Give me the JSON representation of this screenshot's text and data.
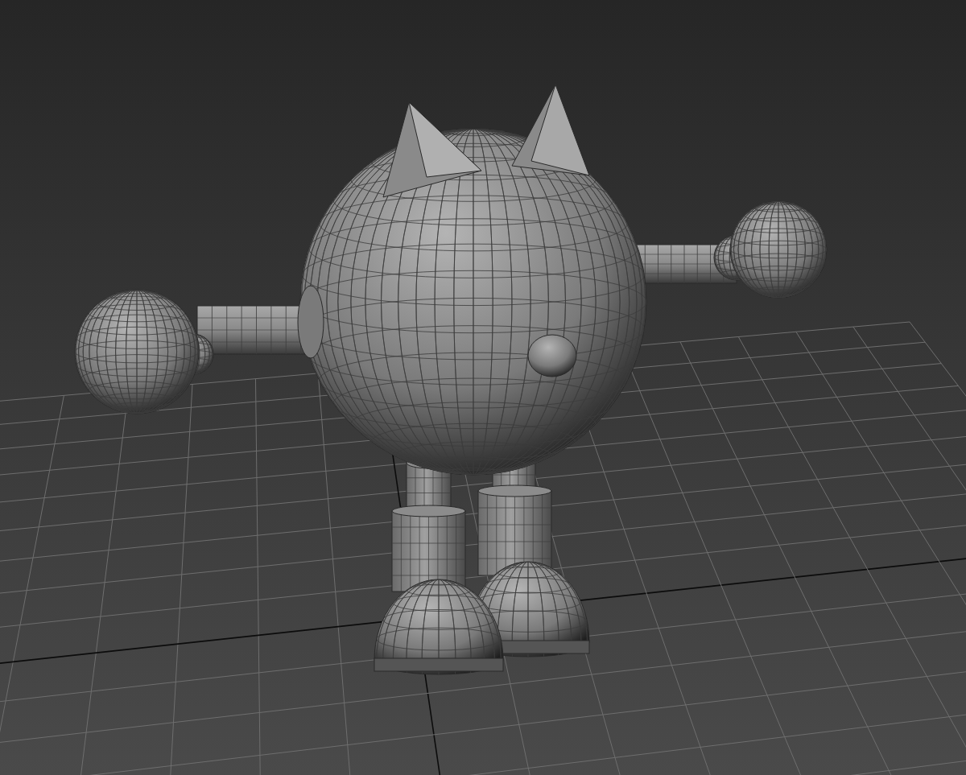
{
  "viewport": {
    "grid": true
  }
}
